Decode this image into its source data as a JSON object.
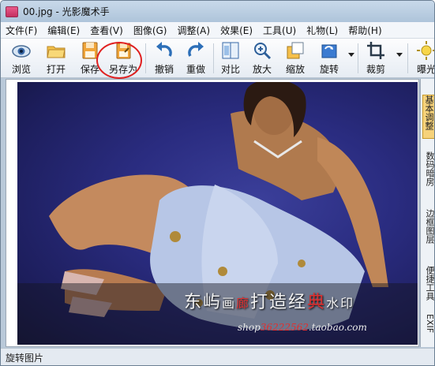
{
  "window": {
    "title": "00.jpg - 光影魔术手"
  },
  "menu": [
    "文件(F)",
    "编辑(E)",
    "查看(V)",
    "图像(G)",
    "调整(A)",
    "效果(E)",
    "工具(U)",
    "礼物(L)",
    "帮助(H)"
  ],
  "toolbar": {
    "browse": "浏览",
    "open": "打开",
    "save": "保存",
    "save_as": "另存为",
    "undo": "撤销",
    "redo": "重做",
    "compare": "对比",
    "zoom_in": "放大",
    "zoom_out": "缩放",
    "rotate": "旋转",
    "crop": "裁剪",
    "exposure": "曝光"
  },
  "watermark": {
    "part1": "东屿",
    "part2": "画",
    "part3": "廊",
    "part4": "打造经",
    "part5": "典",
    "part6": "水印",
    "url_prefix": "shop",
    "url_number": "36222562",
    "url_suffix": ".taobao.com"
  },
  "side_tabs": [
    "基本调整",
    "数码暗房",
    "边框图层",
    "便捷工具",
    "EXIF"
  ],
  "status": {
    "text": "旋转图片"
  },
  "colors": {
    "accent": "#e02020",
    "titlebar": "#b9cde0",
    "photo_bg": "#2a2c80"
  }
}
